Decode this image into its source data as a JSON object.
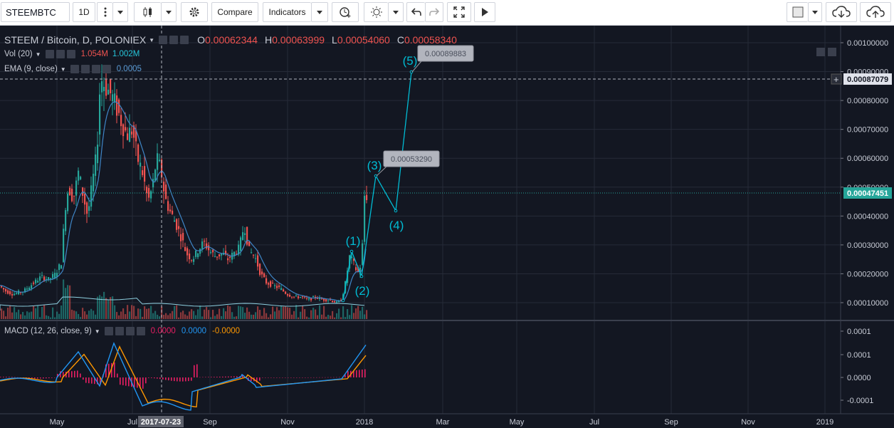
{
  "toolbar": {
    "symbol": "STEEMBTC",
    "interval": "1D",
    "compare_label": "Compare",
    "indicators_label": "Indicators"
  },
  "legend": {
    "title": "STEEM / Bitcoin, D, POLONIEX",
    "o_label": "O",
    "o_value": "0.00062344",
    "h_label": "H",
    "h_value": "0.00063999",
    "l_label": "L",
    "l_value": "0.00054060",
    "c_label": "C",
    "c_value": "0.00058340",
    "vol_label": "Vol (20)",
    "vol_value1": "1.054M",
    "vol_value2": "1.002M",
    "ema_label": "EMA (9, close)",
    "ema_value": "0.0005",
    "macd_label": "MACD (12, 26, close, 9)",
    "macd_v1": "0.0000",
    "macd_v2": "0.0000",
    "macd_v3": "-0.0000"
  },
  "price_axis": {
    "ticks": [
      "0.00100000",
      "0.00090000",
      "0.00080000",
      "0.00070000",
      "0.00060000",
      "0.00050000",
      "0.00040000",
      "0.00030000",
      "0.00020000",
      "0.00010000"
    ],
    "crosshair_price": "0.00087079",
    "last_price": "0.00047451"
  },
  "macd_axis": {
    "ticks": [
      "0.0001",
      "0.0001",
      "0.0000",
      "-0.0001"
    ]
  },
  "time_axis": {
    "ticks": [
      "May",
      "Jul",
      "Sep",
      "Nov",
      "2018",
      "Mar",
      "May",
      "Jul",
      "Sep",
      "Nov",
      "2019"
    ],
    "crosshair_date": "2017-07-23"
  },
  "waves": {
    "labels": [
      "(1)",
      "(2)",
      "(3)",
      "(4)",
      "(5)"
    ],
    "callout_3": "0.00053290",
    "callout_5": "0.00089883"
  },
  "colors": {
    "bg": "#131722",
    "up": "#26a69a",
    "down": "#ef5350",
    "wave": "#00bcd4",
    "ema": "#26c6da",
    "macd": "#2196f3",
    "signal": "#ff9800",
    "hist": "#e91e63"
  }
}
